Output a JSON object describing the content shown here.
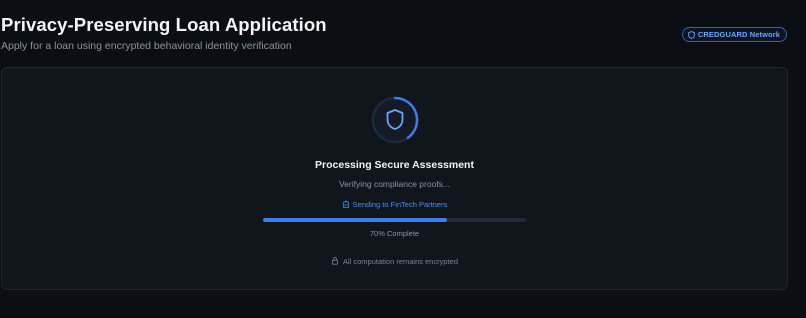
{
  "header": {
    "title": "Privacy-Preserving Loan Application",
    "subtitle": "Apply for a loan using encrypted behavioral identity verification",
    "network_badge": {
      "icon": "shield-icon",
      "label": "CREDGUARD Network"
    }
  },
  "assessment": {
    "spinner_icon": "shield-icon",
    "title": "Processing Secure Assessment",
    "status": "Verifying compliance proofs...",
    "sending": {
      "icon": "building-icon",
      "label": "Sending to FinTech Partners"
    },
    "progress": {
      "percent": 70,
      "label": "70% Complete"
    },
    "footer": {
      "icon": "lock-icon",
      "label": "All computation remains encrypted"
    }
  },
  "colors": {
    "background": "#0b0e13",
    "card": "#11151c",
    "accent": "#3f7ee6",
    "link": "#4d8df5",
    "muted_text": "#8b939f"
  }
}
